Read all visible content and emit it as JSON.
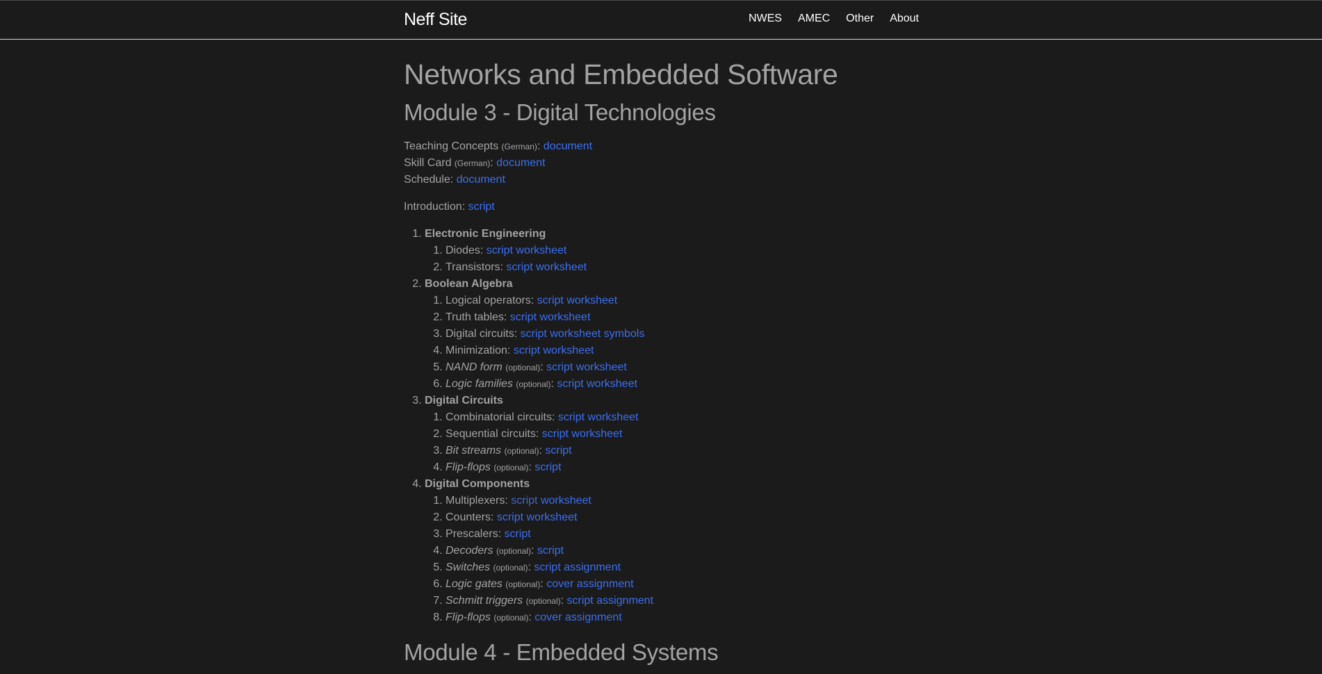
{
  "nav": {
    "brand": "Neff Site",
    "links": [
      "NWES",
      "AMEC",
      "Other",
      "About"
    ]
  },
  "page": {
    "title": "Networks and Embedded Software",
    "module3_title": "Module 3 - Digital Technologies",
    "module4_title": "Module 4 - Embedded Systems"
  },
  "info": {
    "teaching_label": "Teaching Concepts",
    "teaching_lang": "(German)",
    "teaching_link": "document",
    "skill_label": "Skill Card",
    "skill_lang": "(German)",
    "skill_link": "document",
    "schedule_label": "Schedule:",
    "schedule_link": "document",
    "intro_label": "Introduction:",
    "intro_link": "script"
  },
  "labels": {
    "optional": "(optional)",
    "script": "script",
    "worksheet": "worksheet",
    "symbols": "symbols",
    "assignment": "assignment",
    "cover": "cover"
  },
  "sections": [
    {
      "title": "Electronic Engineering",
      "items": [
        {
          "name": "Diodes"
        },
        {
          "name": "Transistors"
        }
      ]
    },
    {
      "title": "Boolean Algebra",
      "items": [
        {
          "name": "Logical operators"
        },
        {
          "name": "Truth tables"
        },
        {
          "name": "Digital circuits"
        },
        {
          "name": "Minimization"
        },
        {
          "name": "NAND form"
        },
        {
          "name": "Logic families"
        }
      ]
    },
    {
      "title": "Digital Circuits",
      "items": [
        {
          "name": "Combinatorial circuits"
        },
        {
          "name": "Sequential circuits"
        },
        {
          "name": "Bit streams"
        },
        {
          "name": "Flip-flops"
        }
      ]
    },
    {
      "title": "Digital Components",
      "items": [
        {
          "name": "Multiplexers"
        },
        {
          "name": "Counters"
        },
        {
          "name": "Prescalers"
        },
        {
          "name": "Decoders"
        },
        {
          "name": "Switches"
        },
        {
          "name": "Logic gates"
        },
        {
          "name": "Schmitt triggers"
        },
        {
          "name": "Flip-flops"
        }
      ]
    }
  ],
  "colors": {
    "background": "#1b1b1b",
    "text": "#a3a3a3",
    "link": "#3b6ef0",
    "link_visited": "#4267c7",
    "nav_text": "#ffffff"
  }
}
